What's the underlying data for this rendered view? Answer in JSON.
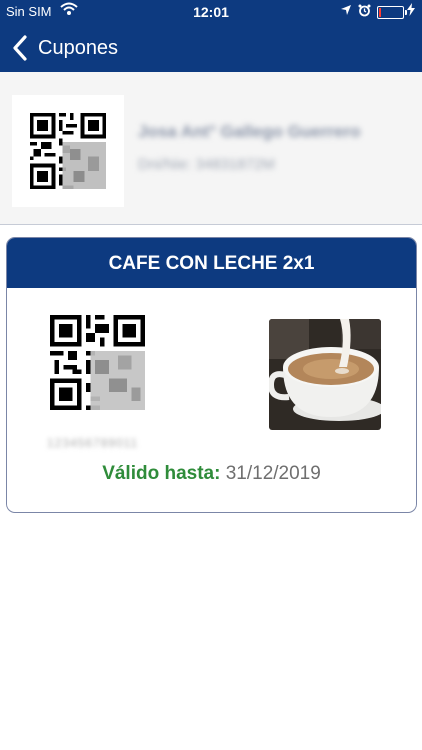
{
  "status_bar": {
    "carrier": "Sin SIM",
    "time": "12:01",
    "battery_level": 0.1,
    "icons": [
      "wifi-icon",
      "location-arrow-icon",
      "alarm-icon",
      "battery-icon",
      "charging-icon"
    ]
  },
  "nav": {
    "back_icon": "chevron-left-icon",
    "title": "Cupones"
  },
  "profile": {
    "qr_icon": "qr-code-icon",
    "name": "Josa Ant° Gallego Guerrero",
    "id_line": "Dni/Nie: 34831872M"
  },
  "coupon": {
    "title": "CAFE CON LECHE 2x1",
    "qr_icon": "qr-code-icon",
    "code": "123456789011",
    "image": "coffee-with-milk-photo",
    "valid_label": "Válido hasta:",
    "valid_date": "31/12/2019"
  },
  "colors": {
    "header": "#0d3a80",
    "valid_label": "#2f8c3a",
    "card_border": "#7b86a7"
  }
}
